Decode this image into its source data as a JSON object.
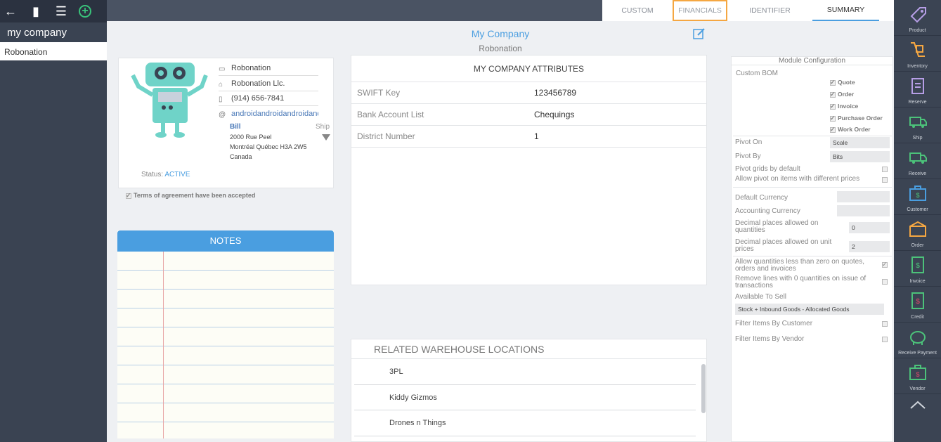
{
  "left": {
    "company": "my company",
    "items": [
      "Robonation"
    ]
  },
  "tabs": [
    "CUSTOM",
    "FINANCIALS",
    "IDENTIFIER",
    "SUMMARY"
  ],
  "header": {
    "title": "My Company",
    "subtitle": "Robonation"
  },
  "card": {
    "name": "Robonation",
    "legal_name": "Robonation Llc.",
    "phone": "(914) 656-7841",
    "email": "androidandroidandroidandroid",
    "bill_label": "Bill",
    "ship_label": "Ship",
    "address": [
      "2000 Rue Peel",
      "Montréal Québec H3A 2W5",
      "Canada"
    ],
    "status_label": "Status:",
    "status_value": "ACTIVE",
    "terms": "Terms of agreement have been accepted"
  },
  "notes": {
    "title": "NOTES"
  },
  "attributes": {
    "title": "MY COMPANY ATTRIBUTES",
    "rows": [
      {
        "key": "SWIFT Key",
        "value": "123456789"
      },
      {
        "key": "Bank Account List",
        "value": "Chequings"
      },
      {
        "key": "District Number",
        "value": "1"
      }
    ]
  },
  "warehouse": {
    "title": "RELATED WAREHOUSE LOCATIONS",
    "rows": [
      "3PL",
      "Kiddy Gizmos",
      "Drones n Things"
    ]
  },
  "module": {
    "title": "Module Configuration",
    "custom_bom": "Custom BOM",
    "bom_items": [
      "Quote",
      "Order",
      "Invoice",
      "Purchase Order",
      "Work Order"
    ],
    "pivot_on_label": "Pivot On",
    "pivot_on_value": "Scale",
    "pivot_by_label": "Pivot By",
    "pivot_by_value": "Bits",
    "pivot_grids": "Pivot grids by default",
    "allow_pivot": "Allow pivot on items with different prices",
    "default_currency": "Default Currency",
    "accounting_currency": "Accounting Currency",
    "decimal_qty_label": "Decimal places allowed on quantities",
    "decimal_qty_value": "0",
    "decimal_price_label": "Decimal places allowed on unit prices",
    "decimal_price_value": "2",
    "allow_negative": "Allow quantities less than zero on quotes, orders and invoices",
    "remove_zero": "Remove lines with 0 quantities on issue of transactions",
    "available_label": "Available To Sell",
    "available_value": "Stock + Inbound Goods - Allocated Goods",
    "filter_customer": "Filter Items By Customer",
    "filter_vendor": "Filter Items By Vendor"
  },
  "rail": [
    "Product",
    "Inventory",
    "Reserve",
    "Ship",
    "Receive",
    "Customer",
    "Order",
    "Invoice",
    "Credit",
    "Receive Payment",
    "Vendor"
  ]
}
